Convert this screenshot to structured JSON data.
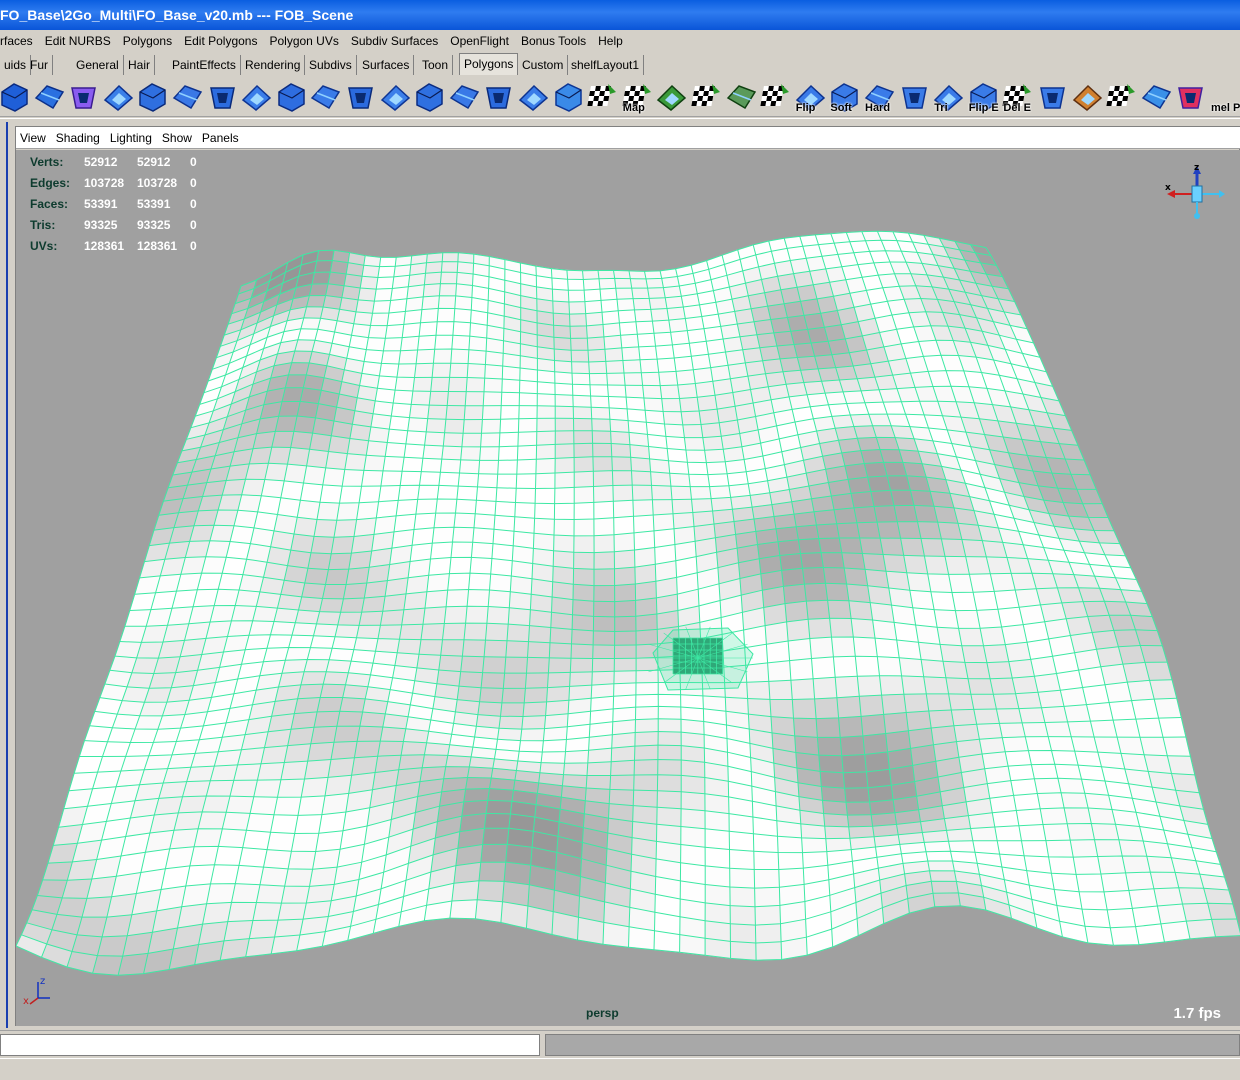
{
  "window": {
    "title": "FO_Base\\2Go_Multi\\FO_Base_v20.mb   ---   FOB_Scene"
  },
  "menubar": {
    "items": [
      "rfaces",
      "Edit NURBS",
      "Polygons",
      "Edit Polygons",
      "Polygon UVs",
      "Subdiv Surfaces",
      "OpenFlight",
      "Bonus Tools",
      "Help"
    ]
  },
  "shelf_tabs": {
    "items": [
      "uids",
      "Fur",
      "General",
      "Hair",
      "PaintEffects",
      "Rendering",
      "Subdivs",
      "Surfaces",
      "Toon",
      "Polygons",
      "Custom",
      "shelfLayout1"
    ],
    "active": "Polygons"
  },
  "shelf_icons": [
    {
      "icon": "sphere-icon",
      "label": ""
    },
    {
      "icon": "split-sphere-icon",
      "label": ""
    },
    {
      "icon": "cube-select-icon",
      "label": ""
    },
    {
      "icon": "extrude-face-icon",
      "label": ""
    },
    {
      "icon": "extrude-edge-icon",
      "label": ""
    },
    {
      "icon": "split-polygon-icon",
      "label": ""
    },
    {
      "icon": "box-icon",
      "label": ""
    },
    {
      "icon": "bevel-icon",
      "label": ""
    },
    {
      "icon": "poke-face-icon",
      "label": ""
    },
    {
      "icon": "wedge-face-icon",
      "label": ""
    },
    {
      "icon": "cut-faces-icon",
      "label": ""
    },
    {
      "icon": "smooth-icon",
      "label": ""
    },
    {
      "icon": "subdivide-icon",
      "label": ""
    },
    {
      "icon": "collapse-icon",
      "label": ""
    },
    {
      "icon": "merge-icon",
      "label": ""
    },
    {
      "icon": "append-polygon-icon",
      "label": ""
    },
    {
      "icon": "sculpt-icon",
      "label": ""
    },
    {
      "icon": "checker-map-icon",
      "label": ""
    },
    {
      "icon": "cut-uv-icon",
      "label": "Map"
    },
    {
      "icon": "uv-move-icon",
      "label": ""
    },
    {
      "icon": "checker-sphere-icon",
      "label": ""
    },
    {
      "icon": "checker-grid-icon",
      "label": ""
    },
    {
      "icon": "uv-layout-icon",
      "label": ""
    },
    {
      "icon": "flip-icon",
      "label": "Flip"
    },
    {
      "icon": "soften-icon",
      "label": "Soft"
    },
    {
      "icon": "harden-icon",
      "label": "Hard"
    },
    {
      "icon": "normal-icon",
      "label": ""
    },
    {
      "icon": "triangulate-icon",
      "label": "Tri"
    },
    {
      "icon": "flip-edge-icon",
      "label": "Flip E"
    },
    {
      "icon": "delete-edge-icon",
      "label": "Del E"
    },
    {
      "icon": "quad-icon",
      "label": ""
    },
    {
      "icon": "paint-icon",
      "label": ""
    },
    {
      "icon": "texture-icon",
      "label": ""
    },
    {
      "icon": "layout-icon",
      "label": ""
    },
    {
      "icon": "book-icon",
      "label": ""
    },
    {
      "icon": "mel-pipe-icon",
      "label": "mel Pipe"
    }
  ],
  "viewport": {
    "menu": [
      "View",
      "Shading",
      "Lighting",
      "Show",
      "Panels"
    ],
    "hud": [
      {
        "key": "Verts:",
        "v1": "52912",
        "v2": "52912",
        "v3": "0"
      },
      {
        "key": "Edges:",
        "v1": "103728",
        "v2": "103728",
        "v3": "0"
      },
      {
        "key": "Faces:",
        "v1": "53391",
        "v2": "53391",
        "v3": "0"
      },
      {
        "key": "Tris:",
        "v1": "93325",
        "v2": "93325",
        "v3": "0"
      },
      {
        "key": "UVs:",
        "v1": "128361",
        "v2": "128361",
        "v3": "0"
      }
    ],
    "camera": "persp",
    "fps": "1.7 fps",
    "gizmo_labels": {
      "x": "x",
      "z": "z"
    },
    "origin_labels": {
      "x": "x",
      "z": "z"
    },
    "wire_color": "#3ee8a4",
    "background_color": "#a0a0a0"
  },
  "command_line": {
    "input_value": "",
    "result_value": ""
  }
}
